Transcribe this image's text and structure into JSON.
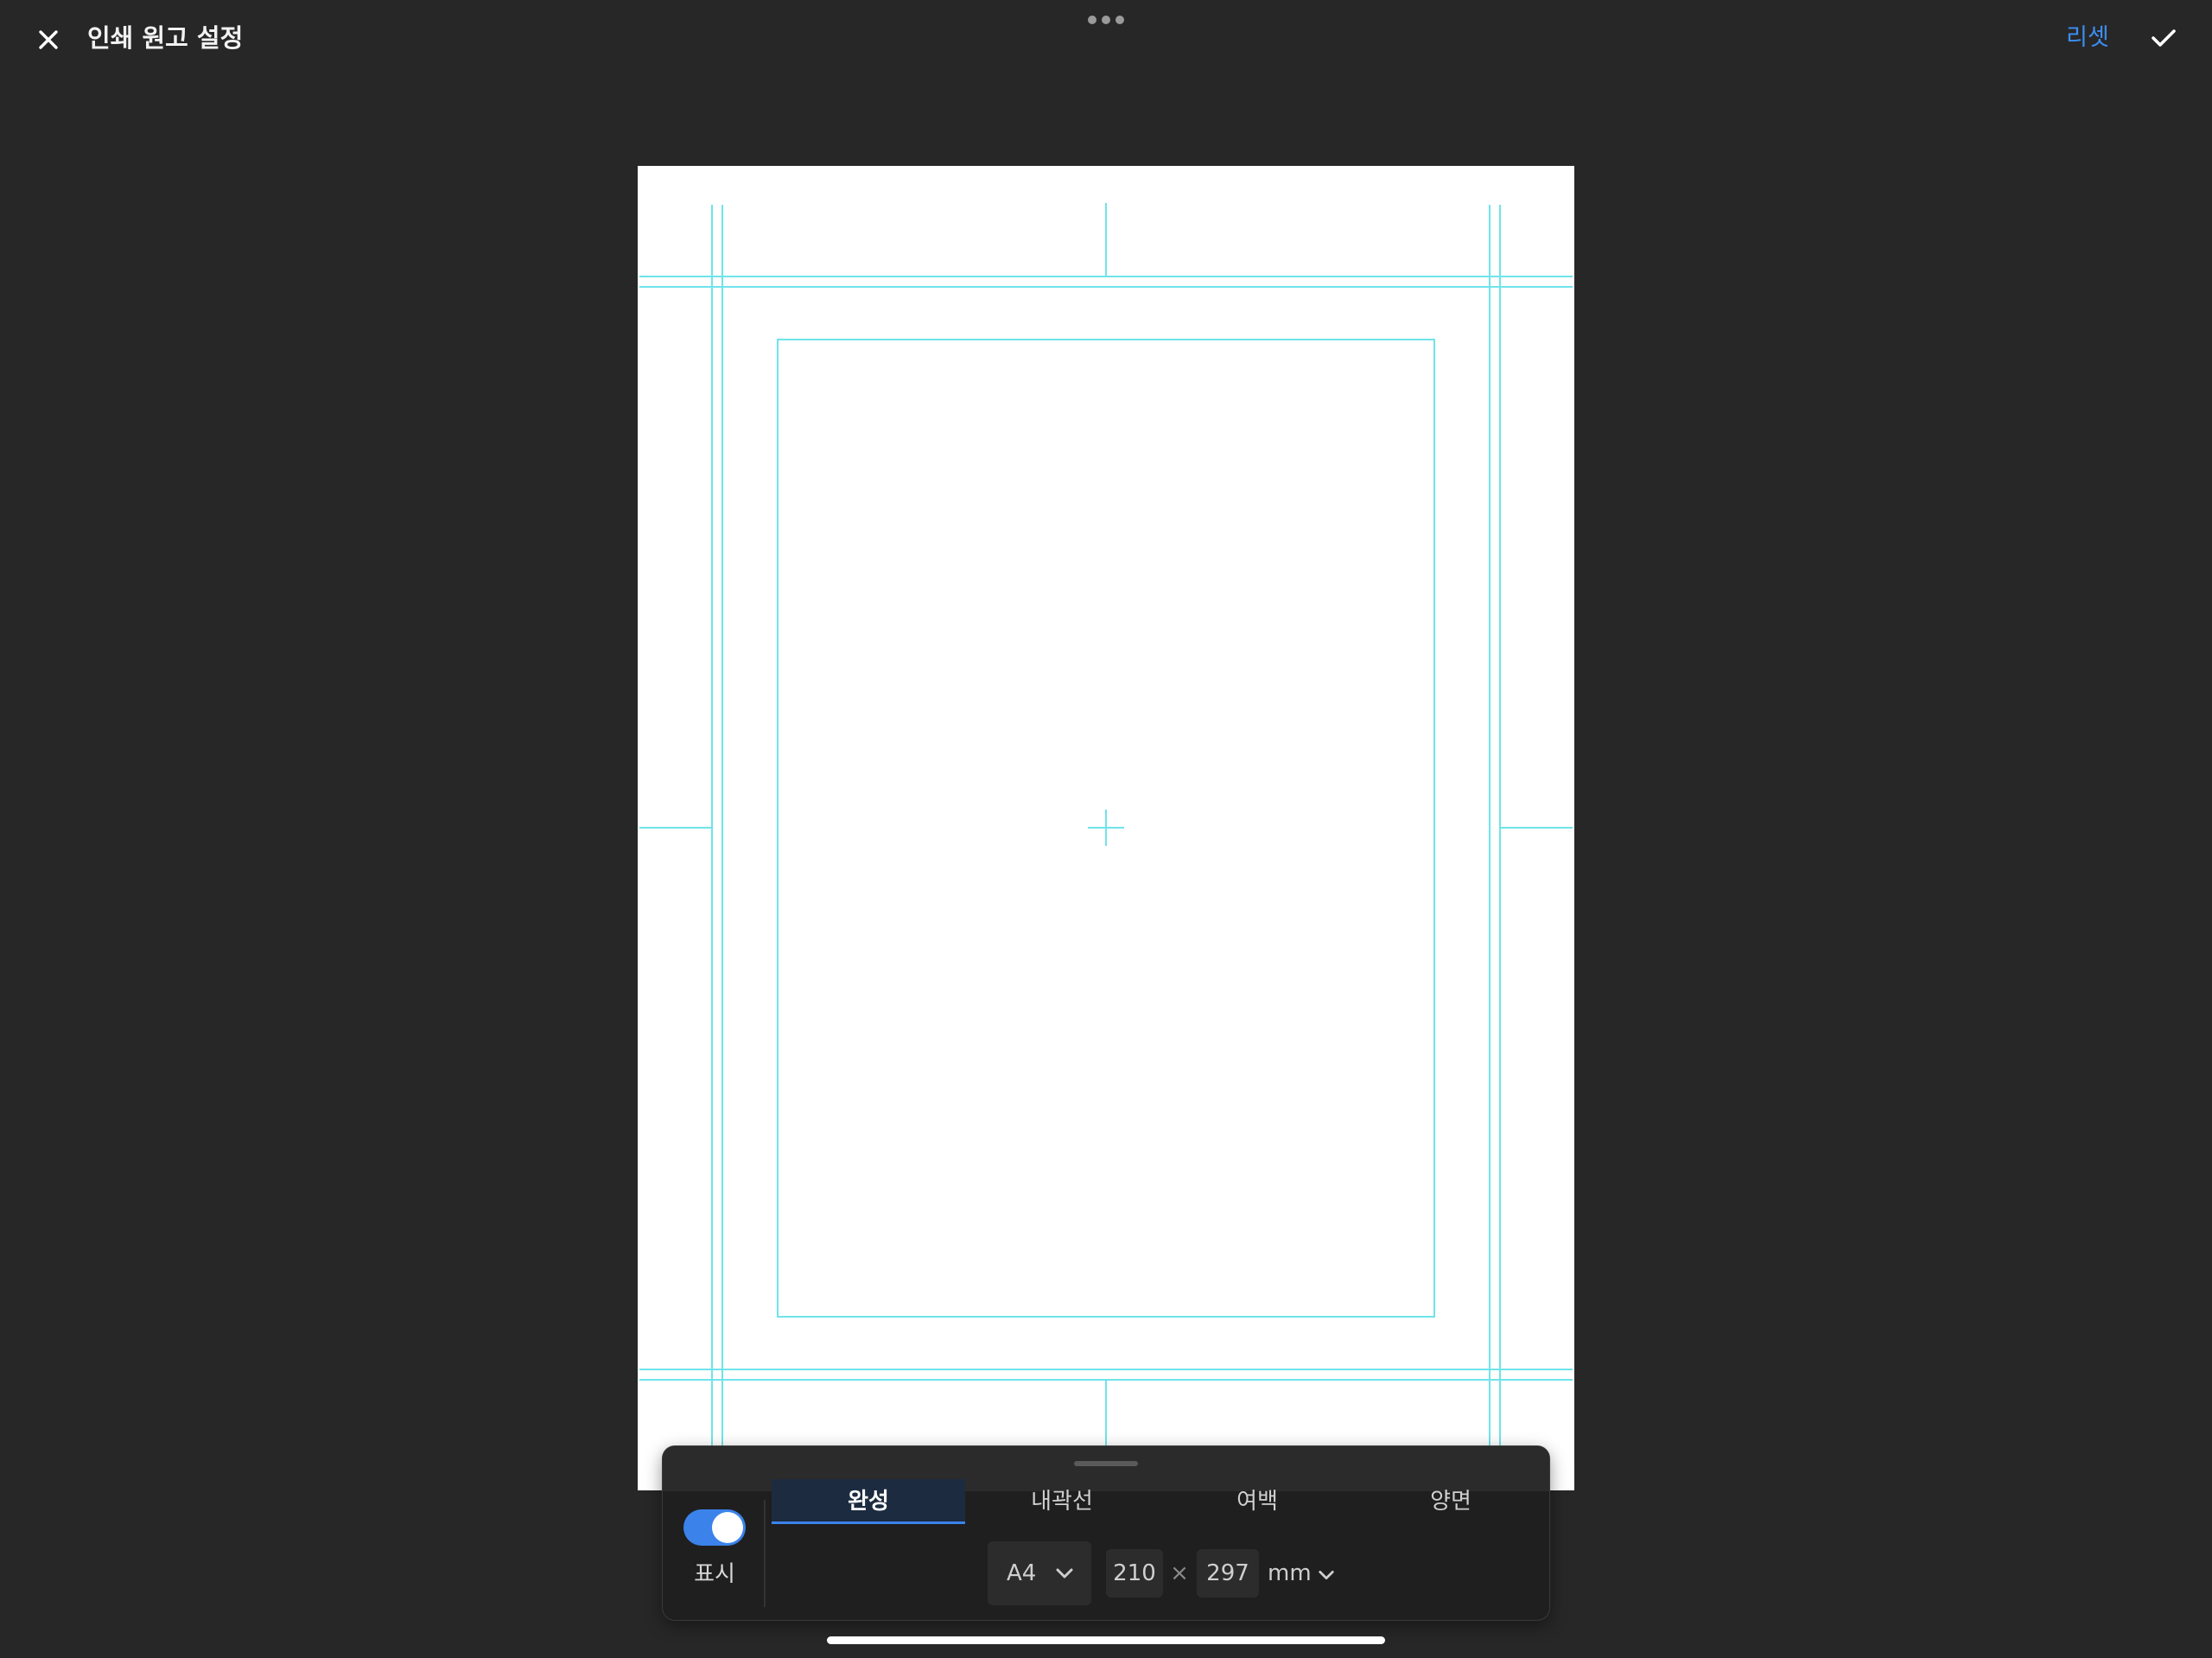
{
  "header": {
    "title": "인쇄 원고 설정",
    "reset_label": "리셋"
  },
  "icons": {
    "close": "close-icon",
    "more": "more-dots-icon",
    "confirm": "checkmark-icon",
    "chevron": "chevron-down-icon"
  },
  "colors": {
    "background": "#272727",
    "canvas": "#ffffff",
    "guide_lines": "#6fe3ea",
    "accent": "#3b83ea",
    "reset_text": "#3d8ef0"
  },
  "panel": {
    "toggle_label": "표시",
    "toggle_on": true,
    "tabs": [
      {
        "label": "완성",
        "active": true
      },
      {
        "label": "내곽선",
        "active": false
      },
      {
        "label": "여백",
        "active": false
      },
      {
        "label": "양면",
        "active": false
      }
    ],
    "paper_size": "A4",
    "width": "210",
    "height": "297",
    "times": "×",
    "unit": "mm"
  }
}
